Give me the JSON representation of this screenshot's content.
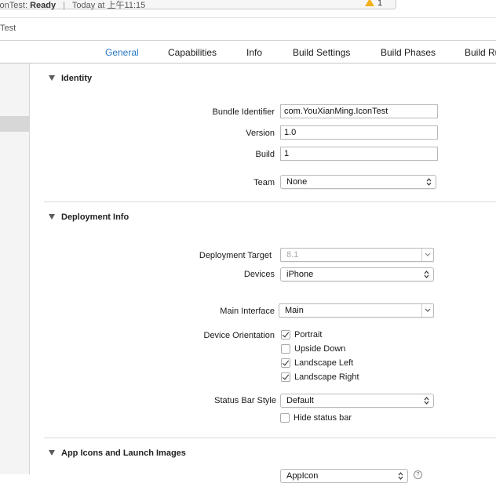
{
  "status": {
    "project": "IconTest:",
    "state": "Ready",
    "separator": "|",
    "time": "Today at 上午11:15",
    "warning_count": "1"
  },
  "breadcrumb": {
    "label": "Test"
  },
  "tabs": [
    {
      "label": "General"
    },
    {
      "label": "Capabilities"
    },
    {
      "label": "Info"
    },
    {
      "label": "Build Settings"
    },
    {
      "label": "Build Phases"
    },
    {
      "label": "Build Ru"
    }
  ],
  "identity": {
    "title": "Identity",
    "bundle_label": "Bundle Identifier",
    "bundle_value": "com.YouXianMing.IconTest",
    "version_label": "Version",
    "version_value": "1.0",
    "build_label": "Build",
    "build_value": "1",
    "team_label": "Team",
    "team_value": "None"
  },
  "deployment": {
    "title": "Deployment Info",
    "target_label": "Deployment Target",
    "target_value": "8.1",
    "devices_label": "Devices",
    "devices_value": "iPhone",
    "interface_label": "Main Interface",
    "interface_value": "Main",
    "orientation_label": "Device Orientation",
    "orientations": [
      {
        "label": "Portrait",
        "checked": true
      },
      {
        "label": "Upside Down",
        "checked": false
      },
      {
        "label": "Landscape Left",
        "checked": true
      },
      {
        "label": "Landscape Right",
        "checked": true
      }
    ],
    "statusbar_label": "Status Bar Style",
    "statusbar_value": "Default",
    "hide_statusbar_label": "Hide status bar",
    "hide_statusbar_checked": false
  },
  "app_icons": {
    "title": "App Icons and Launch Images",
    "source_value": "AppIcon"
  },
  "colors": {
    "accent": "#2879c6",
    "warning": "#f2b21c"
  }
}
